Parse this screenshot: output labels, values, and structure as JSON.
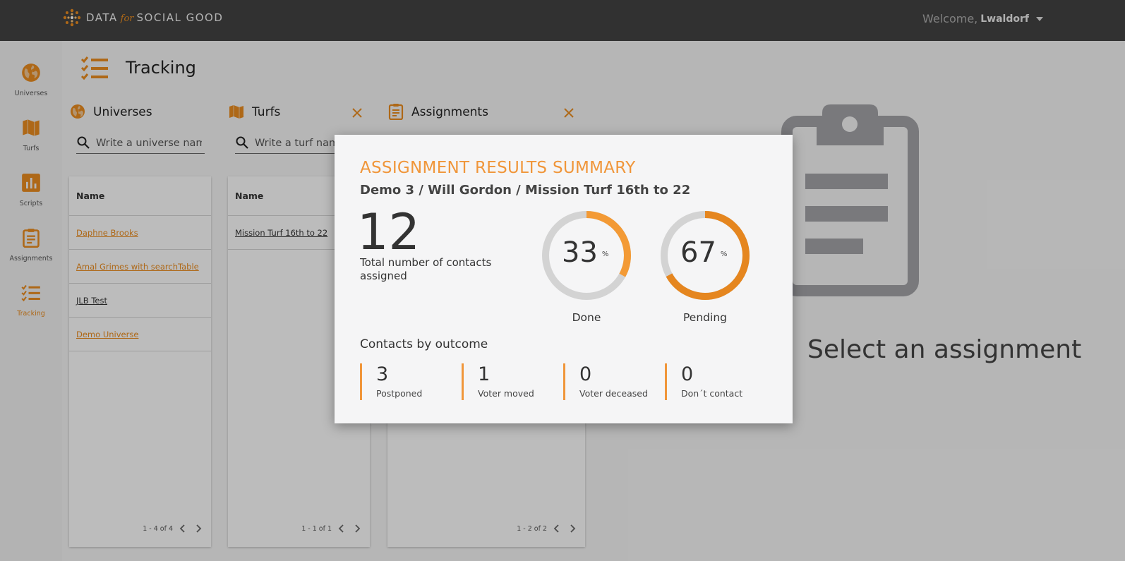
{
  "topbar": {
    "brand_left": "DATA",
    "brand_for": "for",
    "brand_right": "SOCIAL GOOD",
    "welcome_label": "Welcome,",
    "user_name": "Lwaldorf"
  },
  "nav": {
    "items": [
      {
        "label": "Universes",
        "icon": "globe-icon"
      },
      {
        "label": "Turfs",
        "icon": "map-icon"
      },
      {
        "label": "Scripts",
        "icon": "bar-chart-icon"
      },
      {
        "label": "Assignments",
        "icon": "clipboard-icon"
      },
      {
        "label": "Tracking",
        "icon": "checklist-icon",
        "active": true
      }
    ]
  },
  "page": {
    "title": "Tracking"
  },
  "panels": {
    "universes": {
      "title": "Universes",
      "search_placeholder": "Write a universe name",
      "column": "Name",
      "rows": [
        "Daphne Brooks",
        "Amal Grimes with searchTable",
        "JLB Test",
        "Demo Universe"
      ],
      "pager": "1 - 4 of 4"
    },
    "turfs": {
      "title": "Turfs",
      "search_placeholder": "Write a turf name",
      "column": "Name",
      "rows": [
        "Mission Turf 16th to 22"
      ],
      "pager": "1 - 1 of 1"
    },
    "assignments": {
      "title": "Assignments",
      "pager": "1 - 2 of 2"
    }
  },
  "background_message": "Select an assignment",
  "modal": {
    "title": "ASSIGNMENT RESULTS SUMMARY",
    "subtitle": "Demo 3 / Will Gordon / Mission Turf 16th to 22",
    "total": "12",
    "total_label": "Total number of contacts assigned",
    "donuts": [
      {
        "value": 33,
        "unit": "%",
        "label": "Done",
        "color": "#f39a35"
      },
      {
        "value": 67,
        "unit": "%",
        "label": "Pending",
        "color": "#e5861f"
      }
    ],
    "track_color": "#d3d3d3",
    "section_title": "Contacts by outcome",
    "outcomes": [
      {
        "count": "3",
        "label": "Postponed"
      },
      {
        "count": "1",
        "label": "Voter moved"
      },
      {
        "count": "0",
        "label": "Voter deceased"
      },
      {
        "count": "0",
        "label": "Don´t contact"
      }
    ]
  },
  "colors": {
    "accent": "#e5891f",
    "topbar": "#414141"
  }
}
